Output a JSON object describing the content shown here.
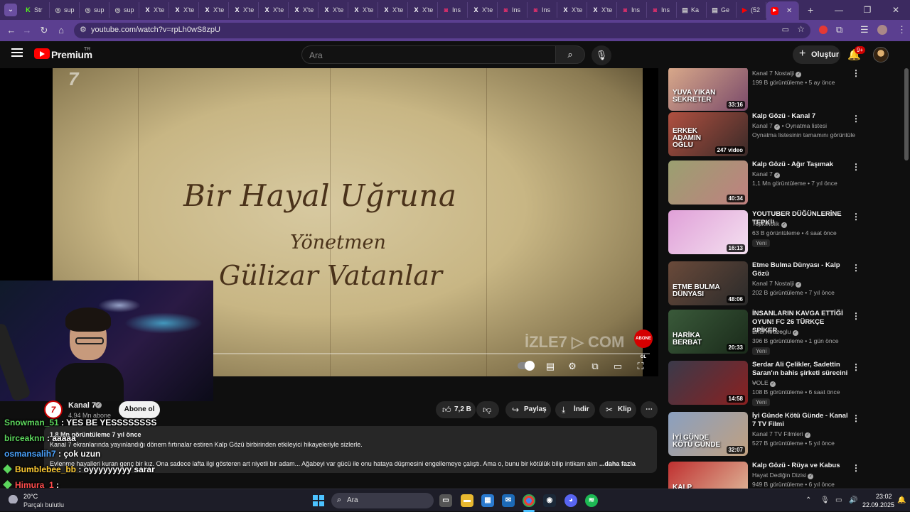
{
  "browser": {
    "tabs": [
      {
        "icon": "K",
        "label": "Str",
        "color": "#53fc18"
      },
      {
        "icon": "◎",
        "label": "sup",
        "color": "#bbbbbb"
      },
      {
        "icon": "◎",
        "label": "sup",
        "color": "#bbbbbb"
      },
      {
        "icon": "◎",
        "label": "sup",
        "color": "#bbbbbb"
      },
      {
        "icon": "X",
        "label": "X'te",
        "color": "#ffffff"
      },
      {
        "icon": "X",
        "label": "X'te",
        "color": "#ffffff"
      },
      {
        "icon": "X",
        "label": "X'te",
        "color": "#ffffff"
      },
      {
        "icon": "X",
        "label": "X'te",
        "color": "#ffffff"
      },
      {
        "icon": "X",
        "label": "X'te",
        "color": "#ffffff"
      },
      {
        "icon": "X",
        "label": "X'te",
        "color": "#ffffff"
      },
      {
        "icon": "X",
        "label": "X'te",
        "color": "#ffffff"
      },
      {
        "icon": "X",
        "label": "X'te",
        "color": "#ffffff"
      },
      {
        "icon": "X",
        "label": "X'te",
        "color": "#ffffff"
      },
      {
        "icon": "X",
        "label": "X'te",
        "color": "#ffffff"
      },
      {
        "icon": "◙",
        "label": "Ins",
        "color": "#e1306c"
      },
      {
        "icon": "X",
        "label": "X'te",
        "color": "#ffffff"
      },
      {
        "icon": "◙",
        "label": "Ins",
        "color": "#e1306c"
      },
      {
        "icon": "◙",
        "label": "Ins",
        "color": "#e1306c"
      },
      {
        "icon": "X",
        "label": "X'te",
        "color": "#ffffff"
      },
      {
        "icon": "X",
        "label": "X'te",
        "color": "#ffffff"
      },
      {
        "icon": "◙",
        "label": "Ins",
        "color": "#e1306c"
      },
      {
        "icon": "◙",
        "label": "Ins",
        "color": "#e1306c"
      },
      {
        "icon": "▤",
        "label": "Ka",
        "color": "#cccccc"
      },
      {
        "icon": "▤",
        "label": "Ge",
        "color": "#cccccc"
      },
      {
        "icon": "▶",
        "label": "(52",
        "color": "#ff0000"
      }
    ],
    "active_tab": {
      "icon": "▶",
      "label": "",
      "color": "#ff0000"
    },
    "url": "youtube.com/watch?v=rpLh0wS8zpU"
  },
  "youtube": {
    "brand": "Premium",
    "region": "TR",
    "search_placeholder": "Ara",
    "create_label": "Oluştur",
    "notif_count": "9+"
  },
  "video": {
    "overlay_lines": [
      "Bir Hayal Uğruna",
      "Yönetmen",
      "Gülizar Vatanlar"
    ],
    "channel_bug": "7",
    "watermark": "İZLE7 ▷ COM",
    "abone_badge": "ABONE OL",
    "channel_name": "Kanal 7",
    "subscribers": "4,94 Mn abone",
    "subscribe_label": "Abone ol",
    "likes": "7,2 B",
    "share_label": "Paylaş",
    "download_label": "İndir",
    "clip_label": "Klip",
    "views_meta": "1,8 Mn görüntüleme  7 yıl önce",
    "desc_line1": "Kanal 7 ekranlarında yayınlandığı dönem fırtınalar estiren Kalp Gözü birbirinden etkileyici hikayeleriyle sizlerle.",
    "desc_line2": "Evlenme hayalleri kuran genç bir kız. Ona sadece lafta ilgi gösteren art niyetli bir adam... Ağabeyi var gücü ile onu hataya düşmesini engellemeye çalıştı. Ama o, bunu bir kötülük bilip intikam alm",
    "desc_more": " ...daha fazla"
  },
  "chat": [
    {
      "user": "Snowman_51",
      "msg": " : YES BE YESSSSSSSS",
      "color": "#5cd65c",
      "badge": false
    },
    {
      "user": "birceaknn",
      "msg": " : aaaaa",
      "color": "#5cd65c",
      "badge": false
    },
    {
      "user": "osmansalih7",
      "msg": " : çok uzun",
      "color": "#4aa3ff",
      "badge": false
    },
    {
      "user": "Bumblebee_bb",
      "msg": " : oyyyyyyyyy sarar",
      "color": "#ffcc33",
      "badge": true
    },
    {
      "user": "Himura_1",
      "msg": " :",
      "color": "#ff4d4d",
      "badge": true
    }
  ],
  "sidebar": [
    {
      "title": "",
      "channel": "Kanal 7 Nostalji",
      "verified": true,
      "stats": "199 B görüntüleme • 5 ay önce",
      "duration": "33:16",
      "caption": "YUVA YIKAN\nSEKRETER",
      "colors": [
        "#d9a98a",
        "#7a4a6a"
      ],
      "new": false
    },
    {
      "title": "Kalp Gözü - Kanal 7",
      "channel": "Kanal 7",
      "verified": true,
      "channel_extra": " • Oynatma listesi",
      "stats": "Oynatma listesinin tamamını görüntüle",
      "duration": "247 video",
      "caption": "ERKEK\nADAMIN\nOĞLU",
      "colors": [
        "#b05040",
        "#3a2a28"
      ],
      "new": false
    },
    {
      "title": "Kalp Gözü - Ağır Taşımak",
      "channel": "Kanal 7",
      "verified": true,
      "stats": "1,1 Mn görüntüleme • 7 yıl önce",
      "duration": "40:34",
      "caption": "",
      "colors": [
        "#9aa070",
        "#c08080"
      ],
      "new": false
    },
    {
      "title": "YOUTUBER DÜĞÜNLERİNE TEPKİ!",
      "channel": "TepkiKolik",
      "verified": true,
      "stats": "63 B görüntüleme • 4 saat önce",
      "duration": "16:13",
      "caption": "",
      "colors": [
        "#e0a0d8",
        "#f4e0f0"
      ],
      "new": true
    },
    {
      "title": "Etme Bulma Dünyası - Kalp Gözü",
      "channel": "Kanal 7 Nostalji",
      "verified": true,
      "stats": "202 B görüntüleme • 7 yıl önce",
      "duration": "48:06",
      "caption": "ETME BULMA\nDÜNYASI",
      "colors": [
        "#6a4a3a",
        "#2a2a2a"
      ],
      "new": false
    },
    {
      "title": "İNSANLARIN KAVGA ETTİĞİ OYUN! FC 26 TÜRKÇE SPİKER...",
      "channel": "Enis Kirazoglu",
      "verified": true,
      "stats": "396 B görüntüleme • 1 gün önce",
      "duration": "20:33",
      "caption": "HARİKA\nBERBAT",
      "colors": [
        "#3a5a3a",
        "#1a2a1a"
      ],
      "new": true
    },
    {
      "title": "Serdar Ali Çelikler, Sadettin Saran'ın bahis şirketi sürecini ...",
      "channel": "VOLE",
      "verified": true,
      "stats": "108 B görüntüleme • 6 saat önce",
      "duration": "14:58",
      "caption": "",
      "colors": [
        "#3a3a4a",
        "#8a2020"
      ],
      "new": true
    },
    {
      "title": "İyi Günde Kötü Günde - Kanal 7 TV Filmi",
      "channel": "Kanal 7 TV Filmleri",
      "verified": true,
      "stats": "527 B görüntüleme • 5 yıl önce",
      "duration": "32:07",
      "caption": "İYİ GÜNDE\nKÖTÜ GÜNDE",
      "colors": [
        "#8aa0c0",
        "#c0a080"
      ],
      "new": false
    },
    {
      "title": "Kalp Gözü - Rüya ve Kabus",
      "channel": "Hayat Dediğin Dizisi",
      "verified": true,
      "stats": "949 B görüntüleme • 6 yıl önce",
      "duration": "",
      "caption": "KALP\nGÖZÜ",
      "colors": [
        "#c03030",
        "#e0c0a0"
      ],
      "new": false
    }
  ],
  "taskbar": {
    "temp": "20°C",
    "weather": "Parçalı bulutlu",
    "search_label": "Ara",
    "time": "23:02",
    "date": "22.09.2025"
  }
}
